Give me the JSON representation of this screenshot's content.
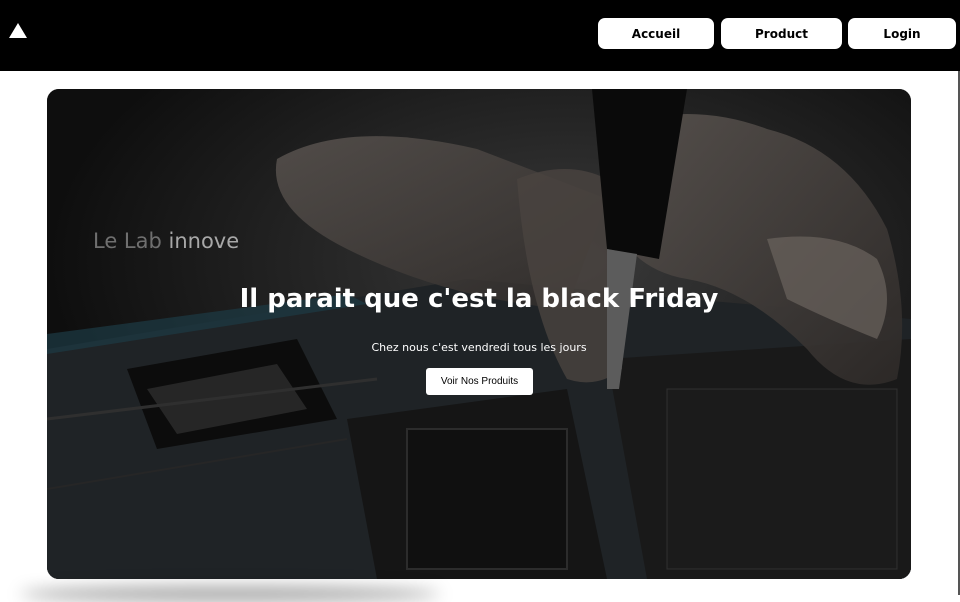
{
  "nav": {
    "logo_icon": "triangle-logo-icon",
    "items": [
      {
        "label": "Accueil"
      },
      {
        "label": "Product"
      },
      {
        "label": "Login"
      }
    ]
  },
  "hero": {
    "tagline_light": "Le Lab ",
    "tagline_strong": "innove",
    "title": "Il parait que c'est la black Friday",
    "subtitle": "Chez nous c'est vendredi tous les jours",
    "cta_label": "Voir Nos Produits"
  },
  "colors": {
    "navbar": "#000000",
    "page_background": "#ffffff",
    "hero_overlay": "#141414",
    "button": "#ffffff"
  }
}
